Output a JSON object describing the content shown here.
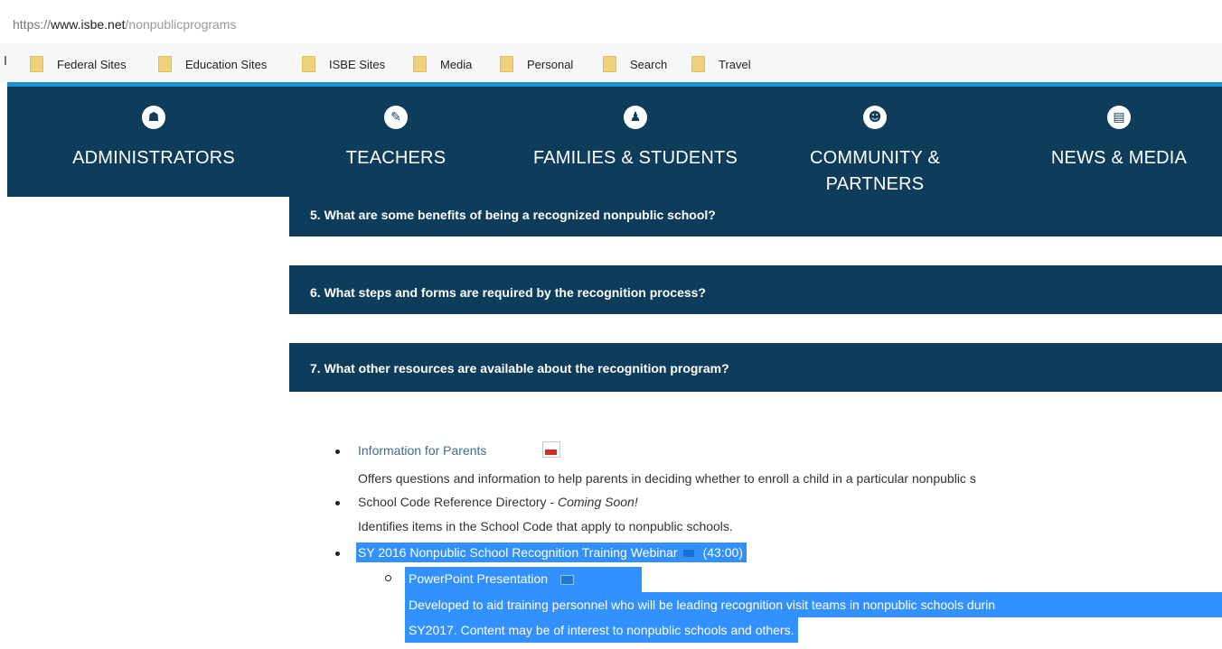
{
  "browser": {
    "url_scheme": "https://",
    "url_host": "www.isbe.net",
    "url_path": "/nonpublicprograms"
  },
  "bookmarks": [
    {
      "label": "Federal Sites",
      "icon": "folder-icon"
    },
    {
      "label": "Education Sites",
      "icon": "folder-icon"
    },
    {
      "label": "ISBE Sites",
      "icon": "folder-icon"
    },
    {
      "label": "Media",
      "icon": "folder-icon"
    },
    {
      "label": "Personal",
      "icon": "folder-icon"
    },
    {
      "label": "Search",
      "icon": "folder-icon"
    },
    {
      "label": "Travel",
      "icon": "folder-icon"
    }
  ],
  "nav": {
    "items": [
      {
        "label": "ADMINISTRATORS",
        "icon": "user-icon",
        "glyph": "☗"
      },
      {
        "label": "TEACHERS",
        "icon": "teacher-icon",
        "glyph": "✎"
      },
      {
        "label": "FAMILIES & STUDENTS",
        "icon": "family-icon",
        "glyph": "♟"
      },
      {
        "label_line1": "COMMUNITY &",
        "label_line2": "PARTNERS",
        "icon": "group-icon",
        "glyph": "☻"
      },
      {
        "label": "NEWS & MEDIA",
        "icon": "newspaper-icon",
        "glyph": "▤"
      }
    ]
  },
  "faq": {
    "q5": "5. What are some benefits of being a recognized nonpublic school?",
    "q6": "6. What steps and forms are required by the recognition process?",
    "q7": "7. What other resources are available about the recognition program?"
  },
  "resources": {
    "item1_link": "Information for Parents",
    "item1_desc": "Offers questions and information to help parents in deciding whether to enroll a child in a particular nonpublic s",
    "item2_text": "School Code Reference Directory - ",
    "item2_note": "Coming Soon!",
    "item2_desc": "Identifies items in the School Code that apply to nonpublic schools.",
    "item3_link": "SY 2016 Nonpublic School Recognition Training Webinar",
    "item3_duration": "(43:00)",
    "sub_link": "PowerPoint Presentation",
    "sub_desc_line1": "Developed to aid training personnel who will be leading recognition visit teams in nonpublic schools durin",
    "sub_desc_line2": "SY2017. Content may be of interest to nonpublic schools and others."
  },
  "colors": {
    "nav_bg": "#0e3d5c",
    "accent_line": "#1a8fd1",
    "selection": "#3390ff",
    "link": "#3b6f8c"
  }
}
